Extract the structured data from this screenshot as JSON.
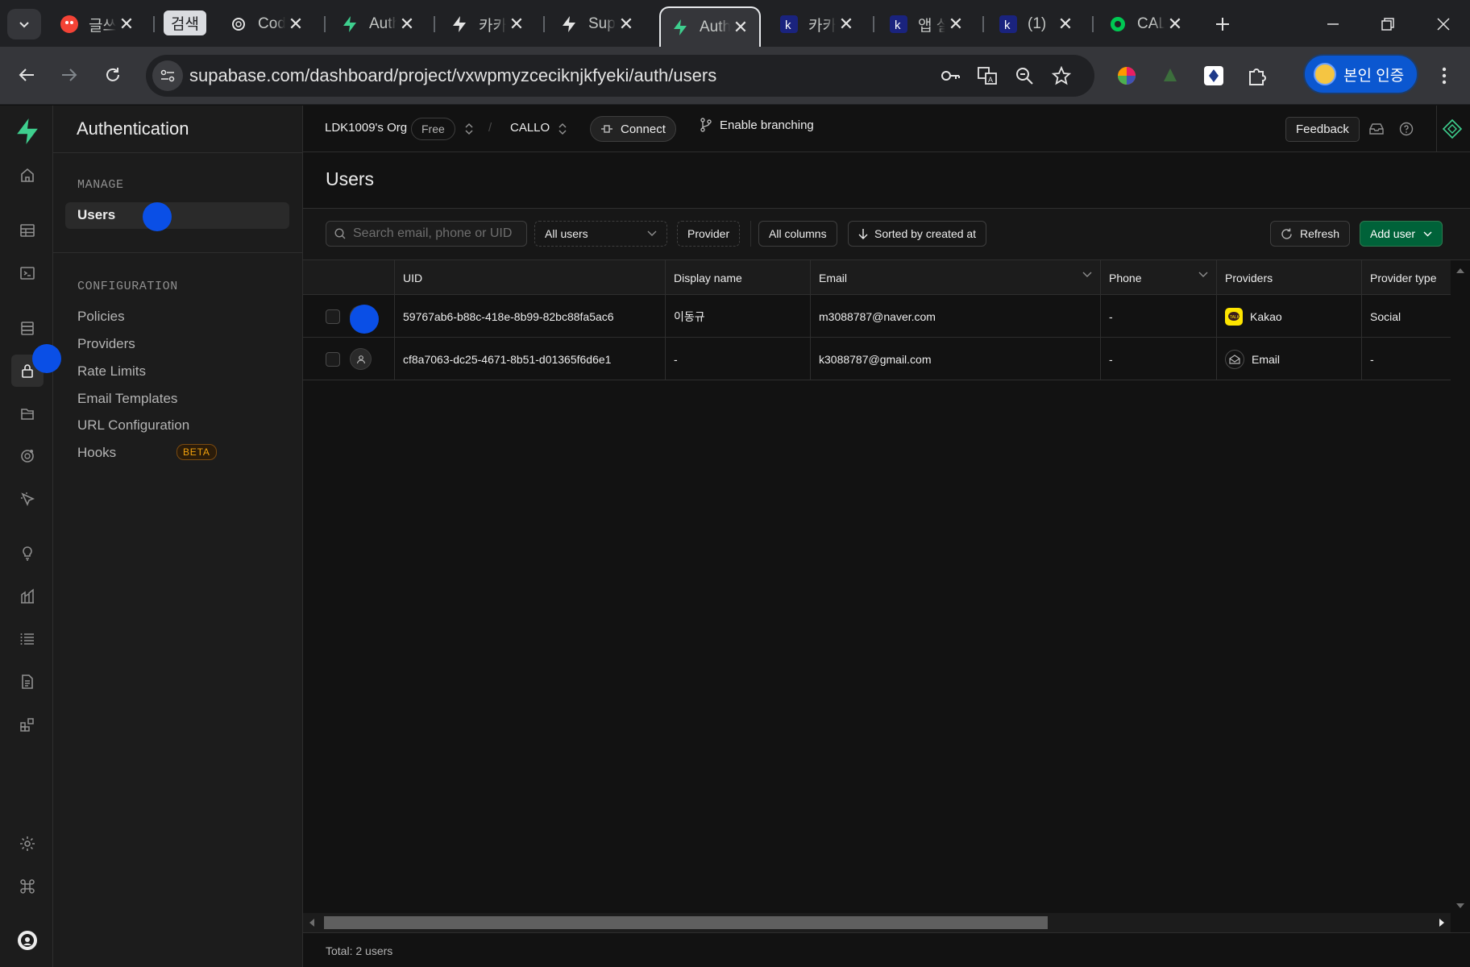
{
  "browser": {
    "tabs": [
      {
        "title": "글쓰기",
        "favicon": "red-app-icon",
        "active": false
      },
      {
        "title": "Codex",
        "favicon": "openai-icon",
        "active": false
      },
      {
        "title": "Auth | Supabase",
        "favicon": "supabase-icon",
        "active": false
      },
      {
        "title": "카카오",
        "favicon": "bolt-icon",
        "active": false
      },
      {
        "title": "Supabase",
        "favicon": "bolt-icon",
        "active": false
      },
      {
        "title": "Auth | Supabase",
        "favicon": "supabase-icon",
        "active": true
      },
      {
        "title": "카카오",
        "favicon": "k-icon",
        "active": false
      },
      {
        "title": "앱 설정",
        "favicon": "k-icon",
        "active": false
      },
      {
        "title": "(1)",
        "favicon": "k-icon",
        "active": false
      },
      {
        "title": "CALLO",
        "favicon": "green-circle-icon",
        "active": false
      }
    ],
    "tab_group_label": "검색",
    "url": "supabase.com/dashboard/project/vxwpmyzceciknjkfyeki/auth/users",
    "profile_label": "본인 인증"
  },
  "app": {
    "section_title": "Authentication",
    "manage_label": "MANAGE",
    "users_label": "Users",
    "configuration_label": "CONFIGURATION",
    "config_items": [
      "Policies",
      "Providers",
      "Rate Limits",
      "Email Templates",
      "URL Configuration",
      "Hooks"
    ],
    "beta_label": "BETA",
    "topbar": {
      "org": "LDK1009's Org",
      "plan": "Free",
      "project": "CALLO",
      "connect": "Connect",
      "branching": "Enable branching",
      "feedback": "Feedback",
      "separator": "/"
    },
    "page_title": "Users",
    "filters": {
      "search_placeholder": "Search email, phone or UID",
      "user_filter": "All users",
      "provider": "Provider",
      "columns": "All columns",
      "sort": "Sorted by created at",
      "refresh": "Refresh",
      "add_user": "Add user"
    },
    "table": {
      "columns": [
        "UID",
        "Display name",
        "Email",
        "Phone",
        "Providers",
        "Provider type"
      ],
      "rows": [
        {
          "uid": "59767ab6-b88c-418e-8b99-82bc88fa5ac6",
          "display_name": "이동규",
          "email": "m3088787@naver.com",
          "phone": "-",
          "provider": "Kakao",
          "provider_icon": "kakao-icon",
          "provider_type": "Social"
        },
        {
          "uid": "cf8a7063-dc25-4671-8b51-d01365f6d6e1",
          "display_name": "-",
          "email": "k3088787@gmail.com",
          "phone": "-",
          "provider": "Email",
          "provider_icon": "mail-icon",
          "provider_type": "-"
        }
      ]
    },
    "footer_total": "Total: 2 users"
  },
  "colors": {
    "brand": "#3ecf8e",
    "add_user_bg": "#006239",
    "beta": "#f1a10d",
    "kakao": "#fee500"
  }
}
